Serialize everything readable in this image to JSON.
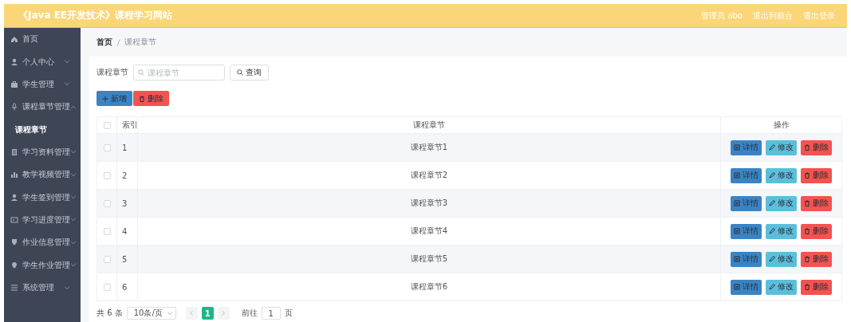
{
  "header": {
    "title": "《Java EE开发技术》课程学习网站",
    "links": [
      "管理员 abo",
      "退出到前台",
      "退出登录"
    ]
  },
  "sidebar": {
    "items": [
      {
        "label": "首页",
        "kind": "link"
      },
      {
        "label": "个人中心",
        "kind": "menu",
        "expanded": false
      },
      {
        "label": "学生管理",
        "kind": "menu",
        "expanded": false
      },
      {
        "label": "课程章节管理",
        "kind": "menu",
        "expanded": true,
        "children": [
          {
            "label": "课程章节",
            "selected": true
          }
        ]
      },
      {
        "label": "学习资料管理",
        "kind": "menu",
        "expanded": false
      },
      {
        "label": "教学视频管理",
        "kind": "menu",
        "expanded": false
      },
      {
        "label": "学生签到管理",
        "kind": "menu",
        "expanded": false
      },
      {
        "label": "学习进度管理",
        "kind": "menu",
        "expanded": false
      },
      {
        "label": "作业信息管理",
        "kind": "menu",
        "expanded": false
      },
      {
        "label": "学生作业管理",
        "kind": "menu",
        "expanded": false
      },
      {
        "label": "系统管理",
        "kind": "menu",
        "expanded": false
      }
    ]
  },
  "breadcrumb": [
    "首页",
    "课程章节"
  ],
  "search": {
    "label": "课程章节",
    "placeholder": "课程章节",
    "button": "查询"
  },
  "actions": [
    {
      "label": "新增",
      "kind": "add"
    },
    {
      "label": "删除",
      "kind": "delete"
    }
  ],
  "table": {
    "select_all": {
      "checked": false
    },
    "columns": [
      "索引",
      "课程章节",
      "操作"
    ],
    "rows": [
      {
        "checked": false,
        "index": "1",
        "name": "课程章节1",
        "actions": [
          {
            "label": "详情",
            "kind": "detail"
          },
          {
            "label": "修改",
            "kind": "edit"
          },
          {
            "label": "删除",
            "kind": "delete"
          }
        ]
      },
      {
        "checked": false,
        "index": "2",
        "name": "课程章节2",
        "actions": [
          {
            "label": "详情",
            "kind": "detail"
          },
          {
            "label": "修改",
            "kind": "edit"
          },
          {
            "label": "删除",
            "kind": "delete"
          }
        ]
      },
      {
        "checked": false,
        "index": "3",
        "name": "课程章节3",
        "actions": [
          {
            "label": "详情",
            "kind": "detail"
          },
          {
            "label": "修改",
            "kind": "edit"
          },
          {
            "label": "删除",
            "kind": "delete"
          }
        ]
      },
      {
        "checked": false,
        "index": "4",
        "name": "课程章节4",
        "actions": [
          {
            "label": "详情",
            "kind": "detail"
          },
          {
            "label": "修改",
            "kind": "edit"
          },
          {
            "label": "删除",
            "kind": "delete"
          }
        ]
      },
      {
        "checked": false,
        "index": "5",
        "name": "课程章节5",
        "actions": [
          {
            "label": "详情",
            "kind": "detail"
          },
          {
            "label": "修改",
            "kind": "edit"
          },
          {
            "label": "删除",
            "kind": "delete"
          }
        ]
      },
      {
        "checked": false,
        "index": "6",
        "name": "课程章节6",
        "actions": [
          {
            "label": "详情",
            "kind": "detail"
          },
          {
            "label": "修改",
            "kind": "edit"
          },
          {
            "label": "删除",
            "kind": "delete"
          }
        ]
      }
    ]
  },
  "pagination": {
    "total": "共 6 条",
    "page_size": "10条/页",
    "pages": [
      {
        "label": "1",
        "selected": true
      }
    ],
    "goto_label": "前往",
    "goto_value": "1",
    "goto_unit": "页"
  }
}
